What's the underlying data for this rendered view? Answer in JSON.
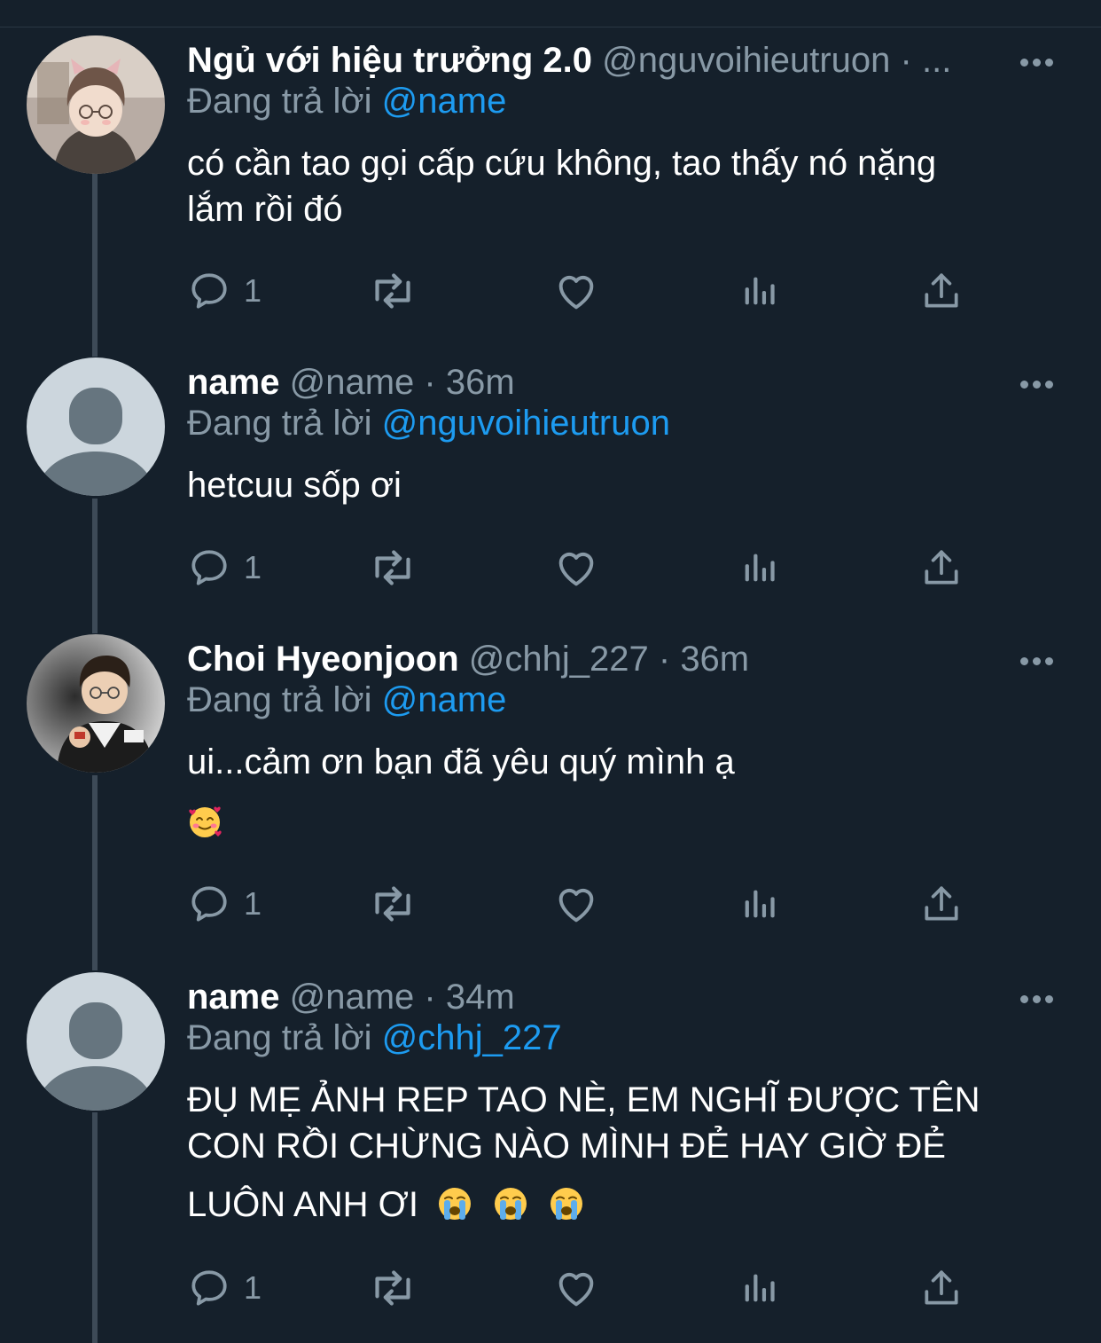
{
  "theme": {
    "background": "#15202b",
    "text": "#ffffff",
    "muted": "#8899a6",
    "link": "#1d9bf0",
    "thread_line": "#3d4a57"
  },
  "icons": {
    "reply": "speech-bubble-icon",
    "retweet": "retweet-arrows-icon",
    "like": "heart-icon",
    "analytics": "bar-chart-icon",
    "share": "upload-share-icon",
    "more": "ellipsis-icon"
  },
  "tweets": [
    {
      "display_name": "Ngủ với hiệu trưởng 2.0",
      "handle": "@nguvoihieutruon",
      "separator": "·",
      "time": "...",
      "avatar": "photo-user-with-cat-ears-filter",
      "replying_prefix": "Đang trả lời",
      "replying_to": "@name",
      "text_lines": [
        "có cần tao gọi cấp cứu không, tao thấy nó nặng",
        "lắm rồi đó"
      ],
      "reply_count": "1"
    },
    {
      "display_name": "name",
      "handle": "@name",
      "separator": "·",
      "time": "36m",
      "avatar": "default-profile-silhouette",
      "replying_prefix": "Đang trả lời",
      "replying_to": "@nguvoihieutruon",
      "text_lines": [
        "hetcuu sốp ơi"
      ],
      "reply_count": "1"
    },
    {
      "display_name": "Choi Hyeonjoon",
      "handle": "@chhj_227",
      "separator": "·",
      "time": "36m",
      "avatar": "photo-player-in-jersey",
      "replying_prefix": "Đang trả lời",
      "replying_to": "@name",
      "text_lines": [
        "ui...cảm ơn bạn đã yêu quý mình ạ"
      ],
      "emoji_line": [
        "smiling-face-with-hearts"
      ],
      "reply_count": "1"
    },
    {
      "display_name": "name",
      "handle": "@name",
      "separator": "·",
      "time": "34m",
      "avatar": "default-profile-silhouette",
      "replying_prefix": "Đang trả lời",
      "replying_to": "@chhj_227",
      "text_lines": [
        "ĐỤ MẸ ẢNH REP TAO NÈ, EM NGHĨ ĐƯỢC TÊN",
        "CON RỒI CHỪNG NÀO MÌNH ĐẺ HAY GIỜ ĐẺ",
        "LUÔN ANH ƠI"
      ],
      "trailing_emojis": [
        "loudly-crying-face",
        "loudly-crying-face",
        "loudly-crying-face"
      ],
      "reply_count": "1"
    }
  ]
}
